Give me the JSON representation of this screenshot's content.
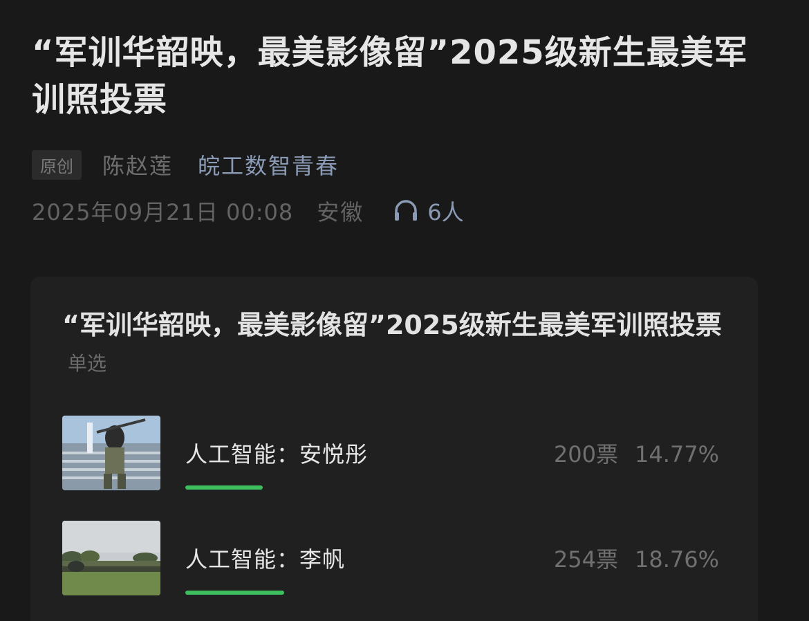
{
  "article": {
    "title": "“军训华韶映，最美影像留”2025级新生最美军训照投票",
    "original_tag": "原创",
    "author": "陈赵莲",
    "account": "皖工数智青春",
    "date": "2025年09月21日 00:08",
    "location": "安徽",
    "listeners": "6人",
    "listen_icon": "headphones-icon"
  },
  "vote": {
    "title": "“军训华韶映，最美影像留”2025级新生最美军训照投票",
    "type": "单选",
    "options": [
      {
        "label": "人工智能：安悦彤",
        "votes": "200票",
        "percent": "14.77%",
        "share": 0.1477,
        "image_icon": "photo-thumbnail-icon"
      },
      {
        "label": "人工智能：李帆",
        "votes": "254票",
        "percent": "18.76%",
        "share": 0.1876,
        "image_icon": "photo-thumbnail-icon"
      }
    ]
  },
  "colors": {
    "background": "#191919",
    "card": "#202020",
    "accent_link": "#8b9bb6",
    "bar": "#3dbe5f"
  }
}
